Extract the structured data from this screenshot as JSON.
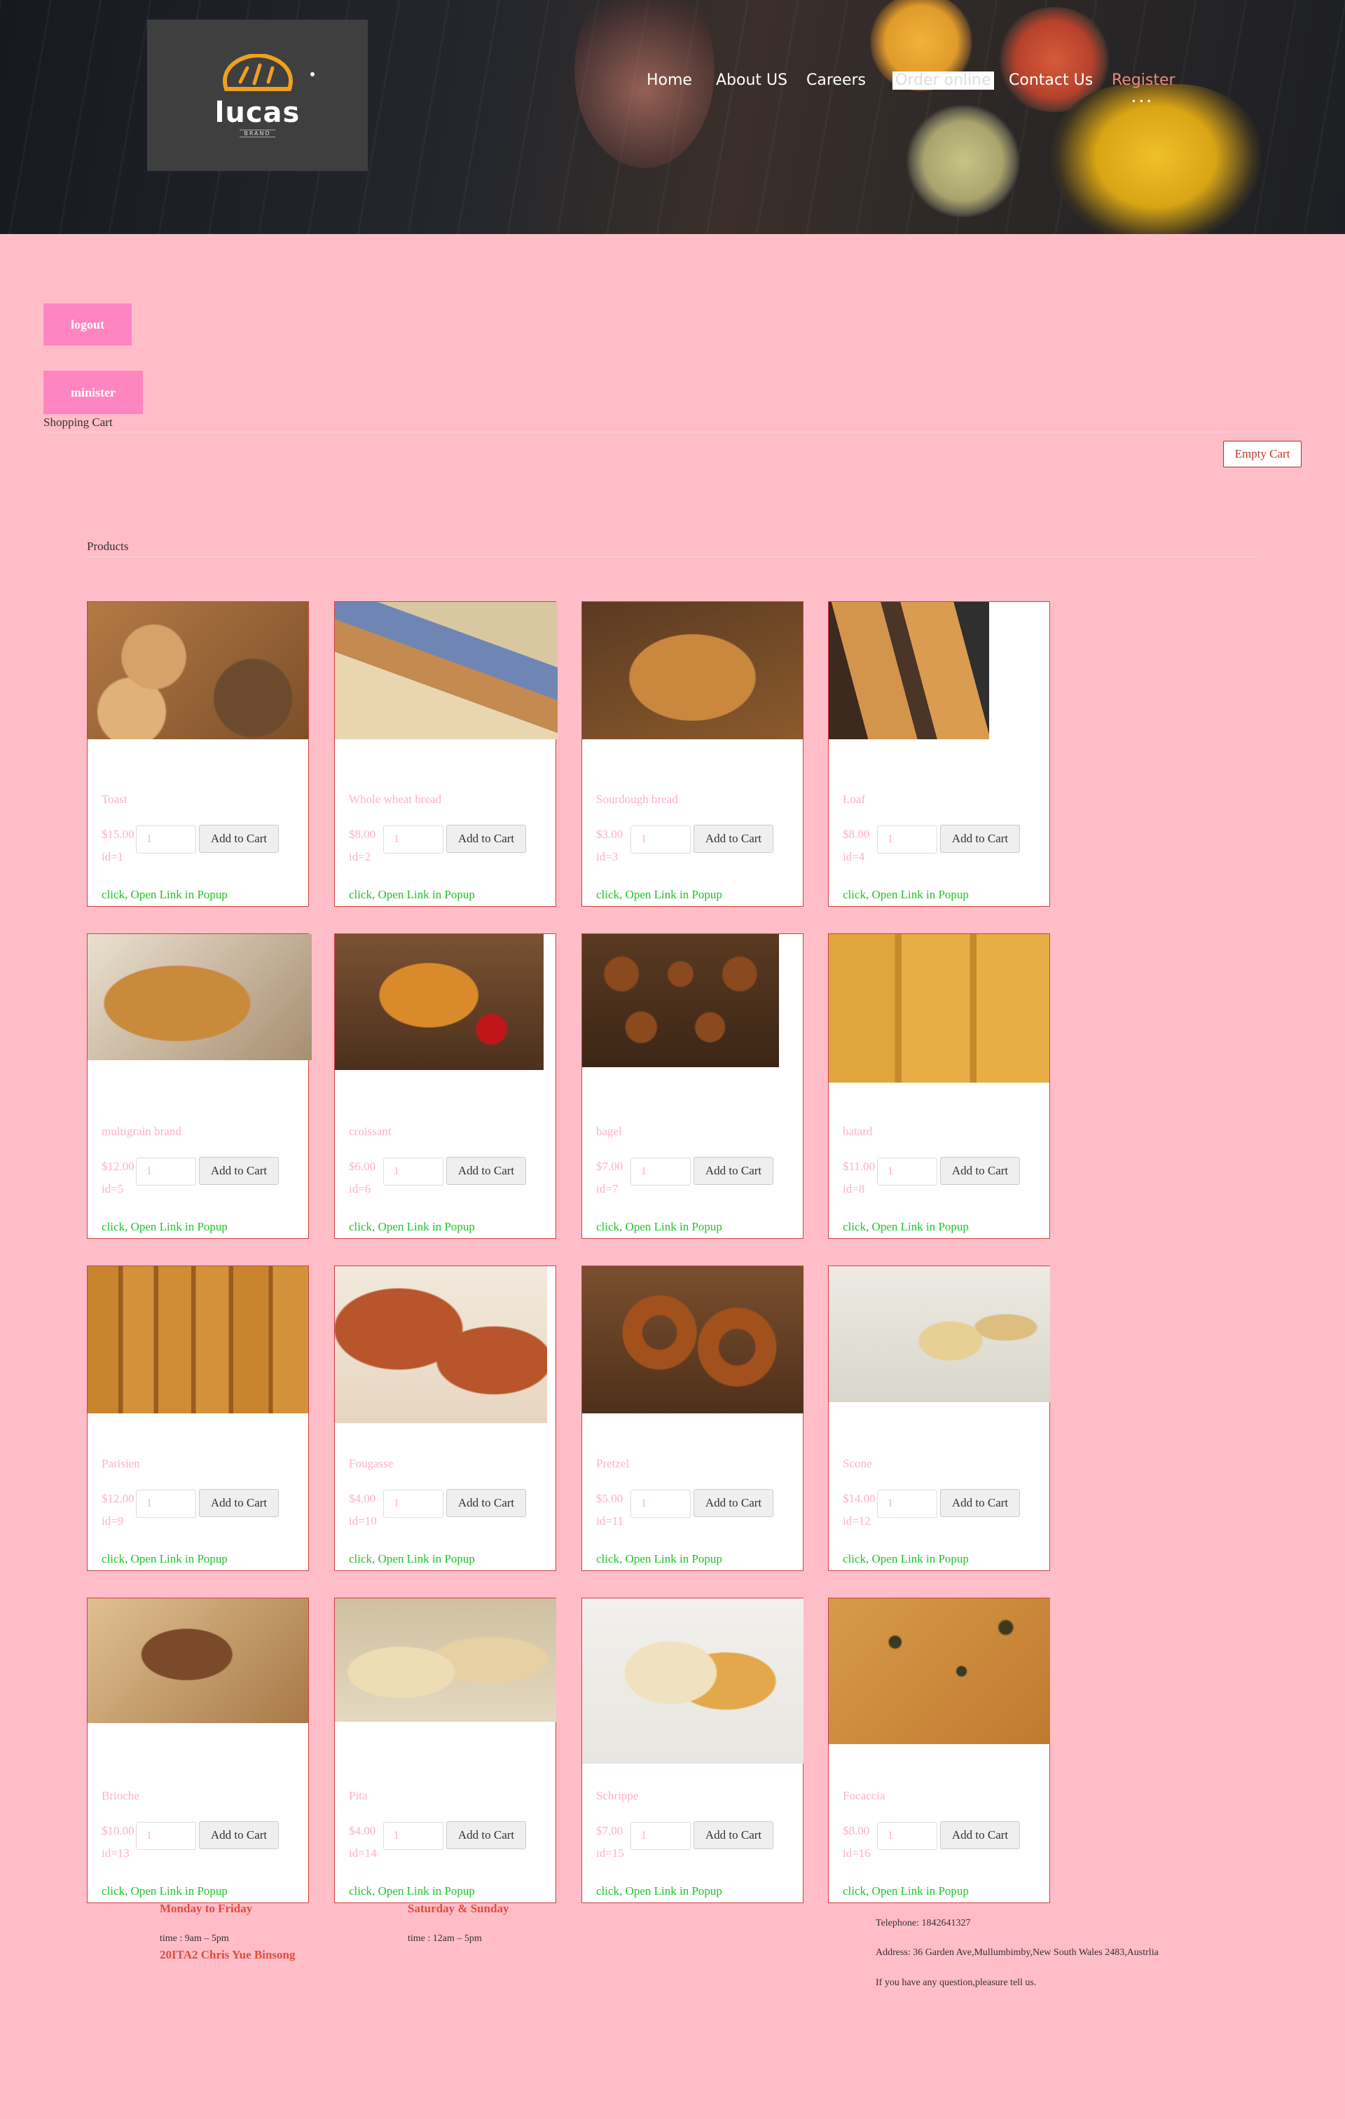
{
  "header": {
    "logo": {
      "text": "lucas",
      "sub": "BRAND"
    },
    "nav": [
      "Home",
      "About US",
      "Careers",
      "Order online",
      "Contact Us",
      "Register"
    ]
  },
  "actions": {
    "logout": "logout",
    "minister": "minister",
    "empty_cart": "Empty Cart"
  },
  "cart": {
    "label": "Shopping Cart"
  },
  "products": {
    "label": "Products",
    "add_label": "Add to Cart",
    "popup_label": "click, Open Link in Popup",
    "qty_default": "1",
    "items": [
      {
        "name": "Toast",
        "price": "$15.00",
        "id": "id=1"
      },
      {
        "name": "Whole wheat bread",
        "price": "$8.00",
        "id": "id=2"
      },
      {
        "name": "Sourdough bread",
        "price": "$3.00",
        "id": "id=3"
      },
      {
        "name": "Loaf",
        "price": "$8.00",
        "id": "id=4"
      },
      {
        "name": "multigrain brand",
        "price": "$12.00",
        "id": "id=5"
      },
      {
        "name": "croissant",
        "price": "$6.00",
        "id": "id=6"
      },
      {
        "name": "bagel",
        "price": "$7.00",
        "id": "id=7"
      },
      {
        "name": "batard",
        "price": "$11.00",
        "id": "id=8"
      },
      {
        "name": "Parisien",
        "price": "$12.00",
        "id": "id=9"
      },
      {
        "name": "Fougasse",
        "price": "$4.00",
        "id": "id=10"
      },
      {
        "name": "Pretzel",
        "price": "$5.00",
        "id": "id=11"
      },
      {
        "name": "Scone",
        "price": "$14.00",
        "id": "id=12"
      },
      {
        "name": "Brioche",
        "price": "$10.00",
        "id": "id=13"
      },
      {
        "name": "Pita",
        "price": "$4.00",
        "id": "id=14"
      },
      {
        "name": "Schrippe",
        "price": "$7.00",
        "id": "id=15"
      },
      {
        "name": "Focaccia",
        "price": "$8.00",
        "id": "id=16"
      }
    ]
  },
  "footer": {
    "weekday_title": "Monday to Friday",
    "weekday_time": "time : 9am – 5pm",
    "credit": "20ITA2 Chris Yue Binsong",
    "weekend_title": "Saturday & Sunday",
    "weekend_time": "time : 12am – 5pm",
    "telephone": "Telephone: 1842641327",
    "address": "Address: 36 Garden Ave,Mullumbimby,New South Wales 2483,Austrlia",
    "question": "If you have any question,pleasure tell us."
  },
  "colors": {
    "page_bg": "#ffbdc8",
    "button_pink": "#ff85c0",
    "link_green": "#1ec42a",
    "footer_title": "#e34b3a"
  }
}
